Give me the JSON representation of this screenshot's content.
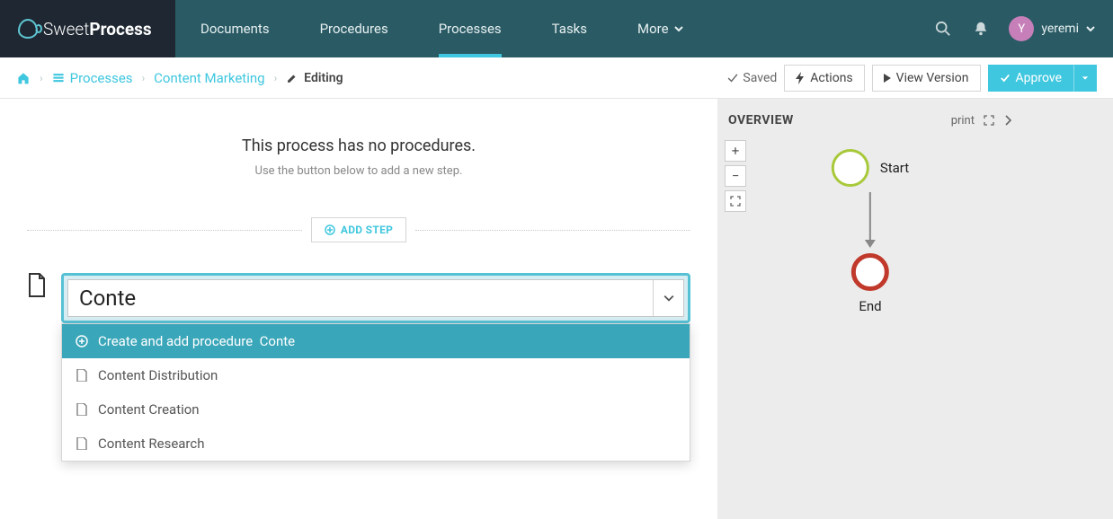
{
  "brand": {
    "light": "Sweet",
    "bold": "Process"
  },
  "nav": {
    "items": [
      {
        "label": "Documents"
      },
      {
        "label": "Procedures"
      },
      {
        "label": "Processes",
        "active": true
      },
      {
        "label": "Tasks"
      },
      {
        "label": "More"
      }
    ]
  },
  "user": {
    "initial": "Y",
    "name": "yeremi"
  },
  "breadcrumbs": {
    "level1": "Processes",
    "level2": "Content Marketing",
    "editing": "Editing"
  },
  "toolbar": {
    "saved": "Saved",
    "actions": "Actions",
    "view_version": "View Version",
    "approve": "Approve"
  },
  "empty_state": {
    "title": "This process has no procedures.",
    "subtitle": "Use the button below to add a new step."
  },
  "add_step_label": "ADD STEP",
  "combo": {
    "value": "Conte",
    "create_prefix": "Create and add procedure",
    "create_value": "Conte",
    "options": [
      "Content Distribution",
      "Content Creation",
      "Content Research"
    ]
  },
  "overview": {
    "title": "OVERVIEW",
    "print": "print",
    "start": "Start",
    "end": "End"
  }
}
